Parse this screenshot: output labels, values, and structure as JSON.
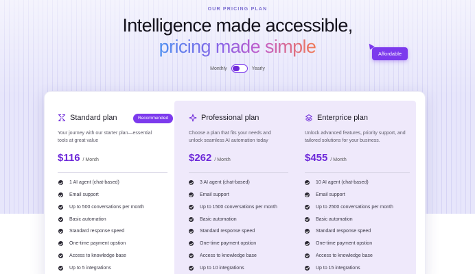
{
  "eyebrow": "OUR PRICING PLAN",
  "headline": "Intelligence made accessible,",
  "subheadline": "pricing made simple",
  "affordable_label": "Affordable",
  "billing_toggle": {
    "monthly_label": "Monthly",
    "yearly_label": "Yearly",
    "selected": "Monthly"
  },
  "colors": {
    "accent": "#7c3aed",
    "price": "#6d28d9",
    "pro_panel": "#efe9fb"
  },
  "plans": [
    {
      "name": "Standard plan",
      "icon": "sparkle-outline-icon",
      "badge": "Recommended",
      "description": "Your journey with our starter plan—essential tools at great value",
      "price": "$116",
      "period": "/ Month",
      "features": [
        "1 AI agent (chat-based)",
        "Email support",
        "Up to 500 conversations per month",
        "Basic automation",
        "Standard response speed",
        "One-time payment opstion",
        "Access to knowledge base",
        "Up to 5 integrations"
      ]
    },
    {
      "name": "Professional plan",
      "icon": "sparkle-icon",
      "description": "Choose a plan that fits your needs and unlock seamless AI automation today",
      "price": "$262",
      "period": "/ Month",
      "features": [
        "3 AI agent (chat-based)",
        "Email support",
        "Up to 1500 conversations per month",
        "Basic automation",
        "Standard response speed",
        "One-time payment opstion",
        "Access to knowledge base",
        "Up to 10 integrations"
      ]
    },
    {
      "name": "Enterprice plan",
      "icon": "layers-icon",
      "description": "Unlock advanced features, priority support, and tailored solutions for your business.",
      "price": "$455",
      "period": "/ Month",
      "features": [
        "10 AI agent (chat-based)",
        "Email support",
        "Up to 2500 conversations per month",
        "Basic automation",
        "Standard response speed",
        "One-time payment opstion",
        "Access to knowledge base",
        "Up to 15 integrations"
      ]
    }
  ]
}
